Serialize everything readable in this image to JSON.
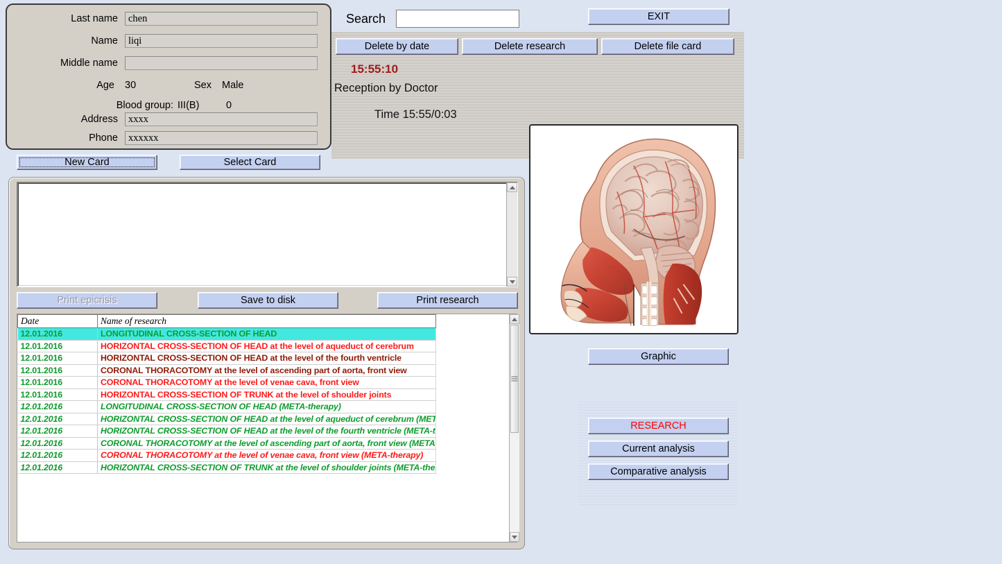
{
  "patient": {
    "last_name_label": "Last name",
    "last_name_value": "chen",
    "name_label": "Name",
    "name_value": "liqi",
    "middle_name_label": "Middle name",
    "middle_name_value": "",
    "age_label": "Age",
    "age_value": "30",
    "sex_label": "Sex",
    "sex_value": "Male",
    "blood_group_label": "Blood group:",
    "blood_group_value": "III(B)",
    "rh_value": "0",
    "address_label": "Address",
    "address_value": "xxxx",
    "phone_label": "Phone",
    "phone_value": "xxxxxx"
  },
  "card_buttons": {
    "new_card": "New Card",
    "select_card": "Select Card"
  },
  "search": {
    "label": "Search",
    "value": "",
    "placeholder": ""
  },
  "toolbar": {
    "exit": "EXIT",
    "delete_by_date": "Delete by date",
    "delete_research": "Delete research",
    "delete_file_card": "Delete file card"
  },
  "session": {
    "clock": "15:55:10",
    "reception_label": "Reception by Doctor",
    "time_label": "Time 15:55/0:03"
  },
  "notes": {
    "text": ""
  },
  "action_buttons": {
    "print_epicrisis": "Print epicrisis",
    "print_epicrisis_disabled": true,
    "save_to_disk": "Save to disk",
    "print_research": "Print research"
  },
  "image_panel": {
    "caption": "Sagittal cross-section of head",
    "graphic_button": "Graphic"
  },
  "analysis_buttons": {
    "research": "RESEARCH",
    "research_color": "#ff0000",
    "current_analysis": "Current analysis",
    "comparative_analysis": "Comparative analysis"
  },
  "research_table": {
    "columns": [
      "Date",
      "Name of research"
    ],
    "rows": [
      {
        "date": "12.01.2016",
        "name": "LONGITUDINAL CROSS-SECTION OF HEAD",
        "color": "#0f9c2e",
        "selected": true,
        "italic": false
      },
      {
        "date": "12.01.2016",
        "name": "HORIZONTAL CROSS-SECTION OF HEAD at the level of aqueduct of cerebrum",
        "color": "#ff1a1a",
        "selected": false,
        "italic": false
      },
      {
        "date": "12.01.2016",
        "name": "HORIZONTAL CROSS-SECTION OF HEAD at the level of the fourth ventricle",
        "color": "#8d1b08",
        "selected": false,
        "italic": false
      },
      {
        "date": "12.01.2016",
        "name": "CORONAL THORACOTOMY at the level of ascending part of aorta, front view",
        "color": "#8d1b08",
        "selected": false,
        "italic": false
      },
      {
        "date": "12.01.2016",
        "name": "CORONAL THORACOTOMY at the level of venae cava, front view",
        "color": "#ff1a1a",
        "selected": false,
        "italic": false
      },
      {
        "date": "12.01.2016",
        "name": "HORIZONTAL CROSS-SECTION OF TRUNK at the level of shoulder joints",
        "color": "#ff1a1a",
        "selected": false,
        "italic": false
      },
      {
        "date": "12.01.2016",
        "name": "LONGITUDINAL CROSS-SECTION OF HEAD (META-therapy)",
        "color": "#0f9c2e",
        "selected": false,
        "italic": true
      },
      {
        "date": "12.01.2016",
        "name": "HORIZONTAL CROSS-SECTION OF HEAD at the level of aqueduct of cerebrum (META-therapy)",
        "color": "#0f9c2e",
        "selected": false,
        "italic": true
      },
      {
        "date": "12.01.2016",
        "name": "HORIZONTAL CROSS-SECTION OF HEAD at the level of the fourth ventricle (META-therapy)",
        "color": "#0f9c2e",
        "selected": false,
        "italic": true
      },
      {
        "date": "12.01.2016",
        "name": "CORONAL THORACOTOMY at the level of ascending part of aorta, front view (META-therapy)",
        "color": "#0f9c2e",
        "selected": false,
        "italic": true
      },
      {
        "date": "12.01.2016",
        "name": "CORONAL THORACOTOMY at the level of venae cava, front view (META-therapy)",
        "color": "#ff1a1a",
        "selected": false,
        "italic": true
      },
      {
        "date": "12.01.2016",
        "name": "HORIZONTAL CROSS-SECTION OF TRUNK at the level of shoulder joints (META-therapy)",
        "color": "#0f9c2e",
        "selected": false,
        "italic": true
      }
    ]
  },
  "colors": {
    "page_background": "#dce4f1",
    "panel_gray": "#d4d0c8",
    "button_blue": "#c3d0f0",
    "selection_cyan": "#42e8e0",
    "clock_red": "#9e1a1a"
  }
}
